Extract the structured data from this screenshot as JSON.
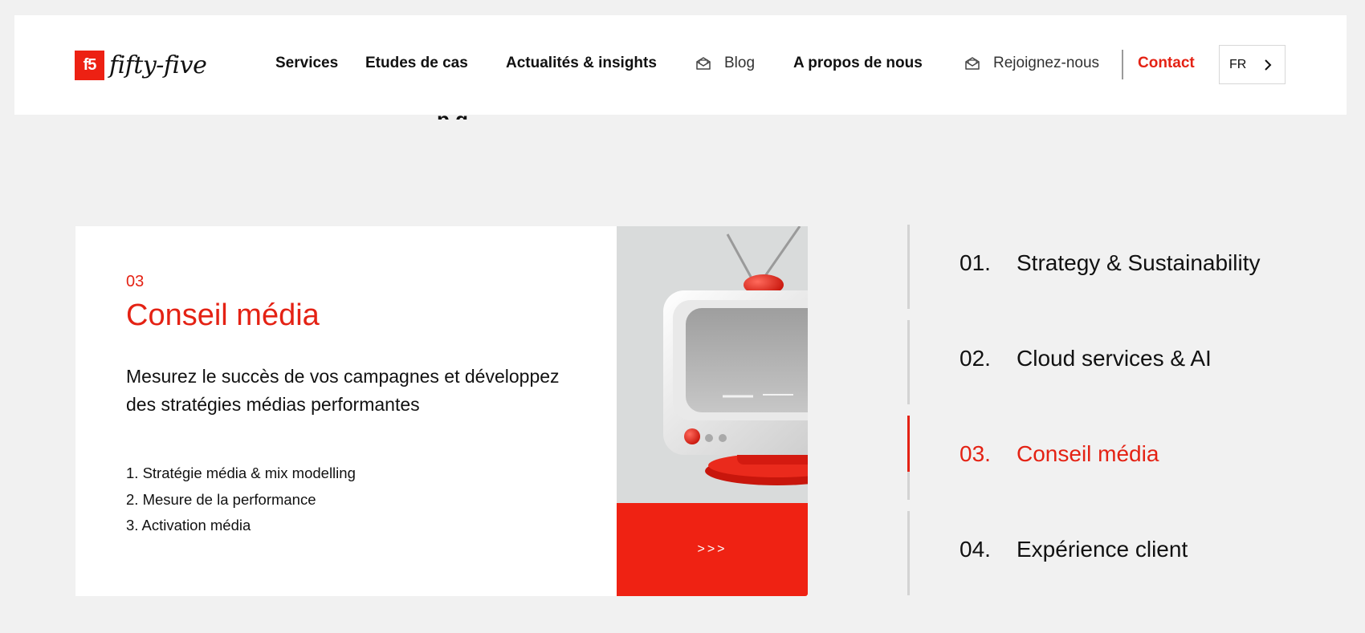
{
  "colors": {
    "accent": "#e42214",
    "background": "#f1f1f1",
    "card": "#ffffff"
  },
  "header": {
    "logo_mark": "f5",
    "logo_text": "fifty-five",
    "nav": [
      {
        "label": "Services"
      },
      {
        "label": "Etudes de cas"
      },
      {
        "label": "Actualités & insights"
      },
      {
        "label": "Blog",
        "icon": "mail-icon"
      },
      {
        "label": "A propos de nous"
      },
      {
        "label": "Rejoignez-nous",
        "icon": "mail-icon"
      },
      {
        "label": "Contact"
      }
    ],
    "language": "FR"
  },
  "card": {
    "number": "03",
    "title": "Conseil média",
    "description": "Mesurez le succès de vos campagnes et développez des stratégies médias performantes",
    "list": [
      "1. Stratégie média & mix modelling",
      "2. Mesure de la performance",
      "3. Activation média"
    ],
    "cta": ">>>",
    "image_icon": "retro-tv-illustration"
  },
  "services": [
    {
      "num": "01.",
      "label": "Strategy & Sustainability",
      "active": false
    },
    {
      "num": "02.",
      "label": "Cloud services & AI",
      "active": false
    },
    {
      "num": "03.",
      "label": "Conseil média",
      "active": true
    },
    {
      "num": "04.",
      "label": "Expérience client",
      "active": false
    }
  ]
}
